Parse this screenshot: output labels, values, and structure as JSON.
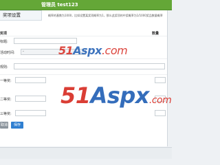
{
  "header": {
    "title": "管理员 test123"
  },
  "section": {
    "title": "奖项设置",
    "description": "概率的基数为1000，比如设置某奖项概率为1，那么此奖项的中奖概率为1/1000奖品数量概率"
  },
  "table": {
    "col_prize": "奖项",
    "col_count": "数量"
  },
  "rows": {
    "title_label": "标题:",
    "start_time_label": "活动时间:",
    "start_time_value": "-",
    "rule_label": "规则:",
    "first_prize_label": "一等奖:",
    "second_prize_label": "二等奖:",
    "third_prize_label": "三等奖:"
  },
  "buttons": {
    "cancel": "取消",
    "save": "保存"
  },
  "watermark": {
    "num": "51",
    "aspx": "Aspx",
    "com": ".com"
  }
}
